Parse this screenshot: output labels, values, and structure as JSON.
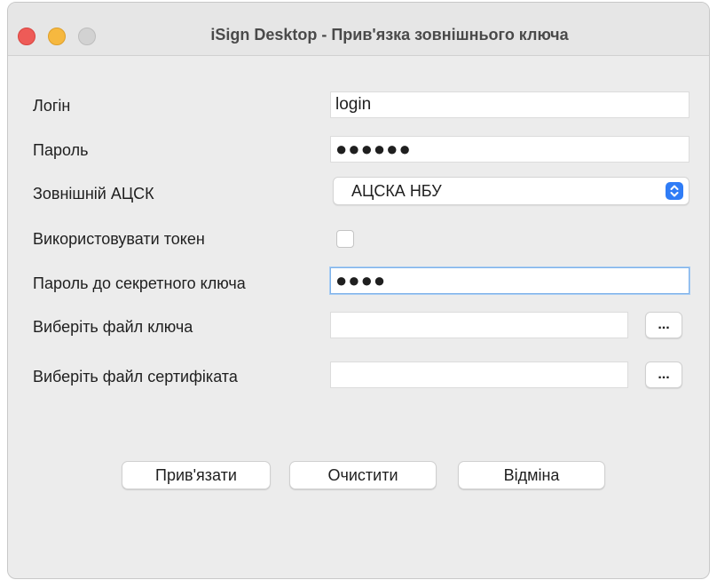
{
  "window": {
    "title": "iSign Desktop - Прив'язка зовнішнього ключа"
  },
  "form": {
    "login": {
      "label": "Логін",
      "value": "login"
    },
    "password": {
      "label": "Пароль",
      "value": "●●●●●●"
    },
    "acsk": {
      "label": "Зовнішній АЦСК",
      "value": "АЦСКА НБУ"
    },
    "use_token": {
      "label": "Використовувати токен",
      "checked": false
    },
    "secret_key_password": {
      "label": "Пароль до секретного ключа",
      "value": "●●●●"
    },
    "key_file": {
      "label": "Виберіть файл ключа",
      "value": "",
      "browse_label": "..."
    },
    "cert_file": {
      "label": "Виберіть файл сертифіката",
      "value": "",
      "browse_label": "..."
    }
  },
  "buttons": {
    "bind": "Прив'язати",
    "clear": "Очистити",
    "cancel": "Відміна"
  },
  "colors": {
    "window_bg": "#ececec",
    "accent": "#2f7cf6",
    "focus_ring": "#7fb2ea",
    "close": "#ee5b57",
    "minimize": "#f6b83f",
    "zoom_disabled": "#d2d2d2"
  },
  "icons": {
    "select_arrow": "chevron-updown-icon"
  }
}
